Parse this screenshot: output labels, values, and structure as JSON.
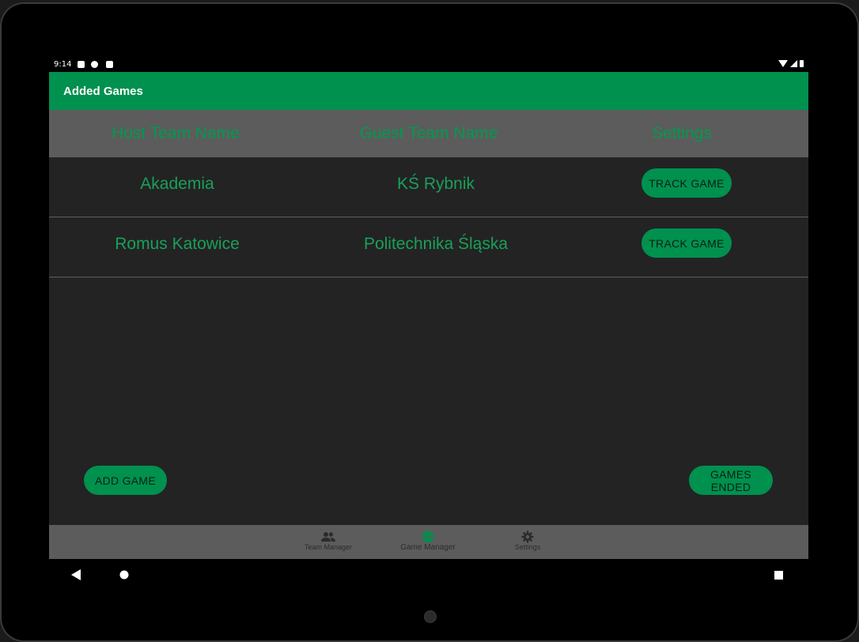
{
  "status_bar": {
    "time": "9:14"
  },
  "app_bar": {
    "title": "Added Games"
  },
  "table": {
    "headers": [
      "Host Team Name",
      "Guest Team Name",
      "Settings"
    ],
    "rows": [
      {
        "host": "Akademia",
        "guest": "KŚ Rybnik",
        "action": "TRACK GAME"
      },
      {
        "host": "Romus Katowice",
        "guest": "Politechnika Śląska",
        "action": "TRACK GAME"
      }
    ]
  },
  "buttons": {
    "add_game": "ADD GAME",
    "games_ended": "GAMES ENDED"
  },
  "bottom_nav": {
    "items": [
      {
        "label": "Team Manager",
        "icon": "people-icon"
      },
      {
        "label": "Game Manager",
        "icon": "ball-icon",
        "active": true
      },
      {
        "label": "Settings",
        "icon": "gear-icon"
      }
    ]
  },
  "colors": {
    "accent": "#00914f",
    "header_bg": "#5c5c5c",
    "content_bg": "#232323",
    "text_green": "#19a05a"
  }
}
